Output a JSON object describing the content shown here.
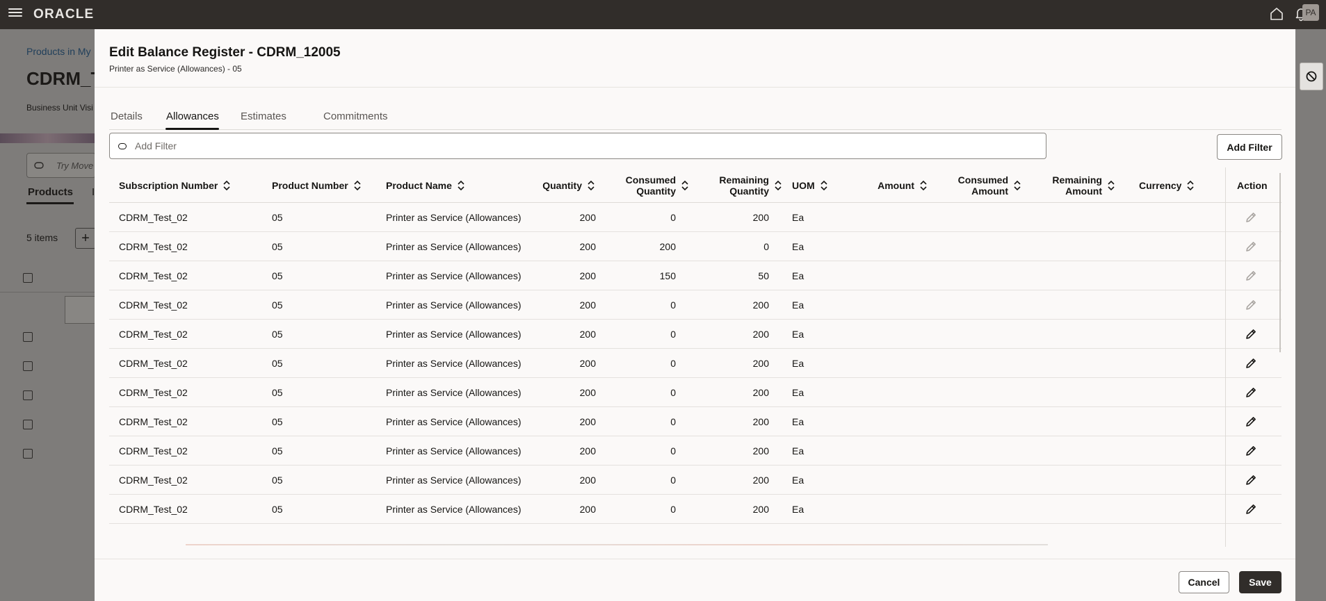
{
  "app": {
    "logo": "ORACLE",
    "avatar_initials": "PA",
    "icons": [
      "menu-icon",
      "home-icon",
      "bell-icon",
      "block-icon"
    ]
  },
  "background": {
    "breadcrumb": "Products in My",
    "title": "CDRM_T",
    "meta": "Business Unit Visi",
    "search_placeholder": "Try Move",
    "tab_products": "Products",
    "tab_second": "I",
    "items_count": "5 items",
    "add_symbol": "+"
  },
  "dialog": {
    "title": "Edit Balance Register - CDRM_12005",
    "subtitle": "Printer as Service (Allowances) - 05",
    "tabs": [
      "Details",
      "Allowances",
      "Estimates",
      "Commitments"
    ],
    "active_tab": "Allowances",
    "filter_placeholder": "Add Filter",
    "add_filter_label": "Add Filter",
    "cancel_label": "Cancel",
    "save_label": "Save"
  },
  "table": {
    "columns": {
      "subscription_number": "Subscription Number",
      "product_number": "Product Number",
      "product_name": "Product Name",
      "quantity": "Quantity",
      "consumed_quantity_1": "Consumed",
      "consumed_quantity_2": "Quantity",
      "remaining_quantity_1": "Remaining",
      "remaining_quantity_2": "Quantity",
      "uom": "UOM",
      "amount": "Amount",
      "consumed_amount_1": "Consumed",
      "consumed_amount_2": "Amount",
      "remaining_amount_1": "Remaining",
      "remaining_amount_2": "Amount",
      "currency": "Currency",
      "action": "Action"
    },
    "rows": [
      {
        "sub": "CDRM_Test_02",
        "pnum": "05",
        "pname": "Printer as Service (Allowances)",
        "qty": "200",
        "cqty": "0",
        "rqty": "200",
        "uom": "Ea",
        "editable": false
      },
      {
        "sub": "CDRM_Test_02",
        "pnum": "05",
        "pname": "Printer as Service (Allowances)",
        "qty": "200",
        "cqty": "200",
        "rqty": "0",
        "uom": "Ea",
        "editable": false
      },
      {
        "sub": "CDRM_Test_02",
        "pnum": "05",
        "pname": "Printer as Service (Allowances)",
        "qty": "200",
        "cqty": "150",
        "rqty": "50",
        "uom": "Ea",
        "editable": false
      },
      {
        "sub": "CDRM_Test_02",
        "pnum": "05",
        "pname": "Printer as Service (Allowances)",
        "qty": "200",
        "cqty": "0",
        "rqty": "200",
        "uom": "Ea",
        "editable": false
      },
      {
        "sub": "CDRM_Test_02",
        "pnum": "05",
        "pname": "Printer as Service (Allowances)",
        "qty": "200",
        "cqty": "0",
        "rqty": "200",
        "uom": "Ea",
        "editable": true
      },
      {
        "sub": "CDRM_Test_02",
        "pnum": "05",
        "pname": "Printer as Service (Allowances)",
        "qty": "200",
        "cqty": "0",
        "rqty": "200",
        "uom": "Ea",
        "editable": true
      },
      {
        "sub": "CDRM_Test_02",
        "pnum": "05",
        "pname": "Printer as Service (Allowances)",
        "qty": "200",
        "cqty": "0",
        "rqty": "200",
        "uom": "Ea",
        "editable": true
      },
      {
        "sub": "CDRM_Test_02",
        "pnum": "05",
        "pname": "Printer as Service (Allowances)",
        "qty": "200",
        "cqty": "0",
        "rqty": "200",
        "uom": "Ea",
        "editable": true
      },
      {
        "sub": "CDRM_Test_02",
        "pnum": "05",
        "pname": "Printer as Service (Allowances)",
        "qty": "200",
        "cqty": "0",
        "rqty": "200",
        "uom": "Ea",
        "editable": true
      },
      {
        "sub": "CDRM_Test_02",
        "pnum": "05",
        "pname": "Printer as Service (Allowances)",
        "qty": "200",
        "cqty": "0",
        "rqty": "200",
        "uom": "Ea",
        "editable": true
      },
      {
        "sub": "CDRM_Test_02",
        "pnum": "05",
        "pname": "Printer as Service (Allowances)",
        "qty": "200",
        "cqty": "0",
        "rqty": "200",
        "uom": "Ea",
        "editable": true
      }
    ]
  },
  "colors": {
    "topbar": "#312d2a",
    "primary_button": "#312d2a",
    "disabled_icon": "#a9a5a1"
  }
}
